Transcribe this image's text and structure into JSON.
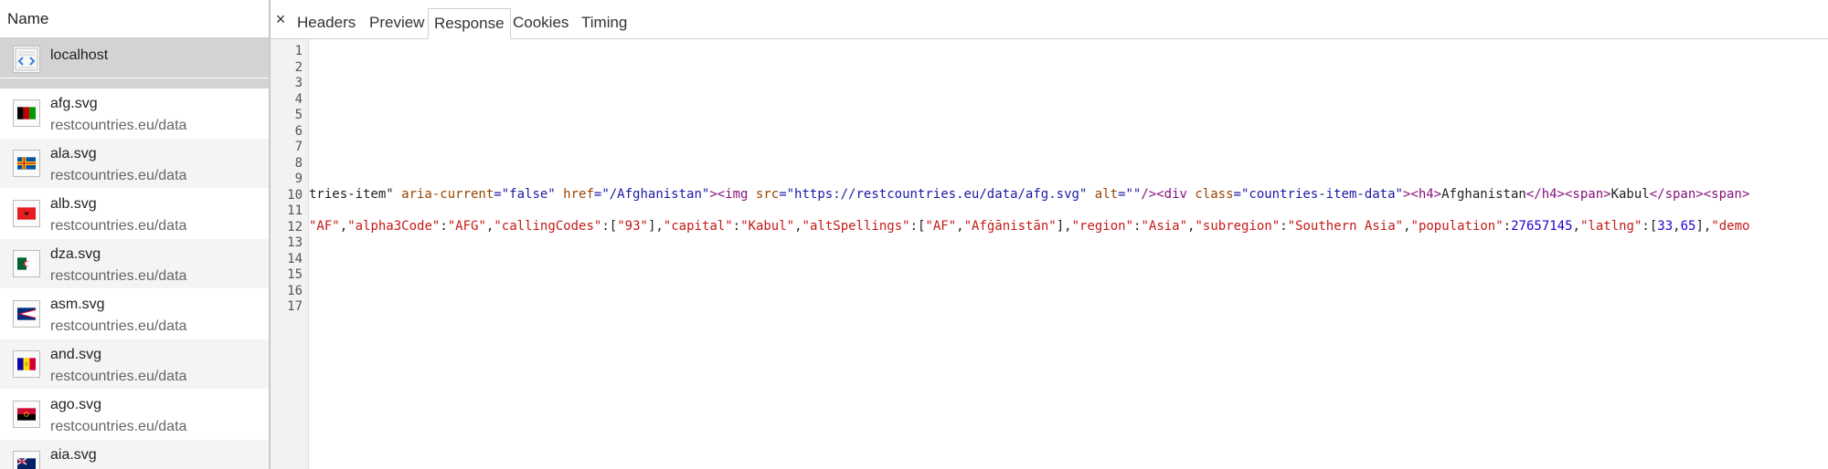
{
  "network": {
    "name_header": "Name",
    "requests": [
      {
        "file": "localhost",
        "domain": "",
        "icon": "html-doc-icon"
      },
      {
        "file": "afg.svg",
        "domain": "restcountries.eu/data",
        "icon": "flag-afg-icon"
      },
      {
        "file": "ala.svg",
        "domain": "restcountries.eu/data",
        "icon": "flag-ala-icon"
      },
      {
        "file": "alb.svg",
        "domain": "restcountries.eu/data",
        "icon": "flag-alb-icon"
      },
      {
        "file": "dza.svg",
        "domain": "restcountries.eu/data",
        "icon": "flag-dza-icon"
      },
      {
        "file": "asm.svg",
        "domain": "restcountries.eu/data",
        "icon": "flag-asm-icon"
      },
      {
        "file": "and.svg",
        "domain": "restcountries.eu/data",
        "icon": "flag-and-icon"
      },
      {
        "file": "ago.svg",
        "domain": "restcountries.eu/data",
        "icon": "flag-ago-icon"
      },
      {
        "file": "aia.svg",
        "domain": "",
        "icon": "flag-aia-icon"
      }
    ]
  },
  "panel": {
    "close_symbol": "×",
    "tabs": [
      "Headers",
      "Preview",
      "Response",
      "Cookies",
      "Timing"
    ],
    "active_tab": "Response"
  },
  "response": {
    "line_numbers": [
      "1",
      "2",
      "3",
      "4",
      "5",
      "6",
      "7",
      "8",
      "9",
      "10",
      "11",
      "12",
      "13",
      "14",
      "15",
      "16",
      "17"
    ],
    "line10": {
      "p1": "tries-item\"",
      "a1": " aria-current",
      "v1": "=\"false\"",
      "a2": " href",
      "v2": "=\"/Afghanistan\"",
      "t1": "><img",
      "a3": " src",
      "v3": "=\"https://restcountries.eu/data/afg.svg\"",
      "a4": " alt",
      "v4": "=\"\"",
      "t2": "/><div",
      "a5": " class",
      "v5": "=\"countries-item-data\"",
      "t3": "><h4>",
      "x1": "Afghanistan",
      "t4": "</h4><span>",
      "x2": "Kabul",
      "t5": "</span><span>"
    },
    "line12": {
      "s1": "\"AF\"",
      "c1": ",",
      "k1": "\"alpha3Code\"",
      "c2": ":",
      "s2": "\"AFG\"",
      "c3": ",",
      "k2": "\"callingCodes\"",
      "c4": ":[",
      "s3": "\"93\"",
      "c5": "],",
      "k3": "\"capital\"",
      "c6": ":",
      "s4": "\"Kabul\"",
      "c7": ",",
      "k4": "\"altSpellings\"",
      "c8": ":[",
      "s5": "\"AF\"",
      "c9": ",",
      "s6": "\"Afġānistān\"",
      "c10": "],",
      "k5": "\"region\"",
      "c11": ":",
      "s7": "\"Asia\"",
      "c12": ",",
      "k6": "\"subregion\"",
      "c13": ":",
      "s8": "\"Southern Asia\"",
      "c14": ",",
      "k7": "\"population\"",
      "c15": ":",
      "n1": "27657145",
      "c16": ",",
      "k8": "\"latlng\"",
      "c17": ":[",
      "n2": "33",
      "c18": ",",
      "n3": "65",
      "c19": "],",
      "k9": "\"demo"
    }
  },
  "colors": {
    "selected_row": "#d3d3d3",
    "tag": "#881280",
    "attr": "#994500",
    "attr_value": "#1a1aa6",
    "json_string": "#c41a16",
    "json_number": "#1c00cf"
  }
}
